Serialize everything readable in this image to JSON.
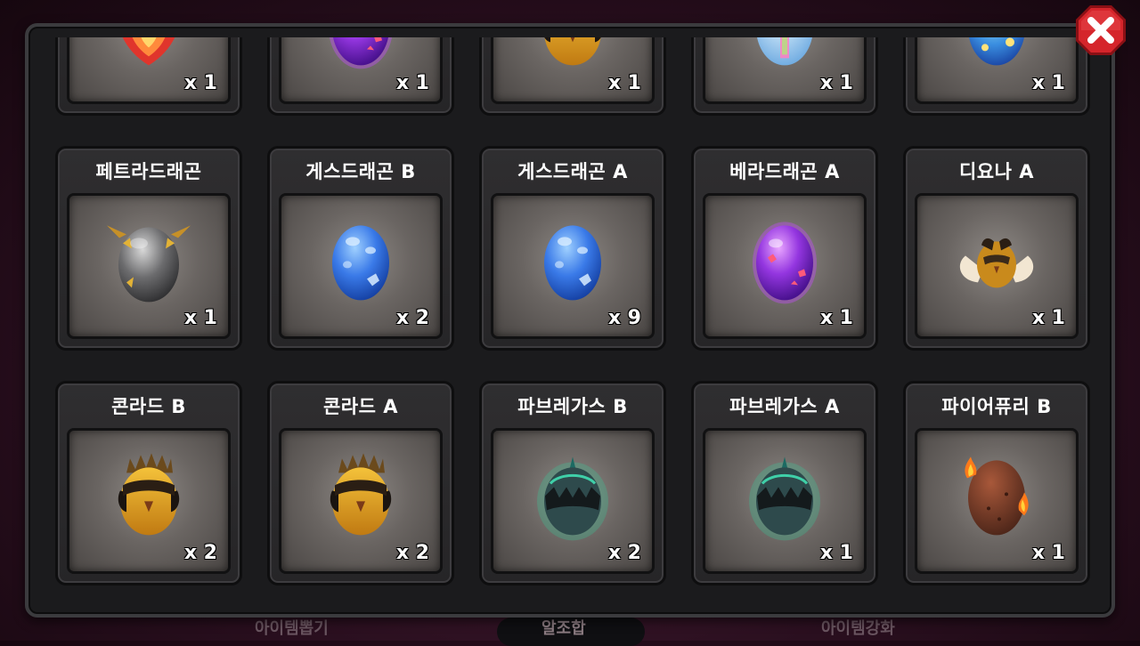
{
  "bottom_tabs": [
    {
      "label": "아이템뽑기",
      "active": false
    },
    {
      "label": "알조합",
      "active": true
    },
    {
      "label": "아이템강화",
      "active": false
    }
  ],
  "close_button": {
    "icon": "close-x-icon",
    "color": "#d5252b"
  },
  "items": [
    {
      "name": "",
      "count": "x 1",
      "icon": "fire-phoenix-egg-icon"
    },
    {
      "name": "",
      "count": "x 1",
      "icon": "purple-egg-icon"
    },
    {
      "name": "",
      "count": "x 1",
      "icon": "golden-beast-egg-icon"
    },
    {
      "name": "",
      "count": "x 1",
      "icon": "rainbow-cross-egg-icon"
    },
    {
      "name": "",
      "count": "x 1",
      "icon": "cyan-egg-icon"
    },
    {
      "name": "페트라드래곤",
      "count": "x 1",
      "icon": "gray-horned-egg-icon"
    },
    {
      "name": "게스드래곤 B",
      "count": "x 2",
      "icon": "blue-spotted-egg-icon"
    },
    {
      "name": "게스드래곤 A",
      "count": "x 9",
      "icon": "blue-spotted-egg-icon"
    },
    {
      "name": "베라드래곤 A",
      "count": "x 1",
      "icon": "purple-egg-icon"
    },
    {
      "name": "디요나 A",
      "count": "x 1",
      "icon": "winged-gold-egg-icon"
    },
    {
      "name": "콘라드 B",
      "count": "x 2",
      "icon": "golden-beast-egg-icon"
    },
    {
      "name": "콘라드 A",
      "count": "x 2",
      "icon": "golden-beast-egg-icon"
    },
    {
      "name": "파브레가스 B",
      "count": "x 2",
      "icon": "dark-spiked-egg-icon"
    },
    {
      "name": "파브레가스 A",
      "count": "x 1",
      "icon": "dark-spiked-egg-icon"
    },
    {
      "name": "파이어퓨리 B",
      "count": "x 1",
      "icon": "flaming-brown-egg-icon"
    }
  ]
}
